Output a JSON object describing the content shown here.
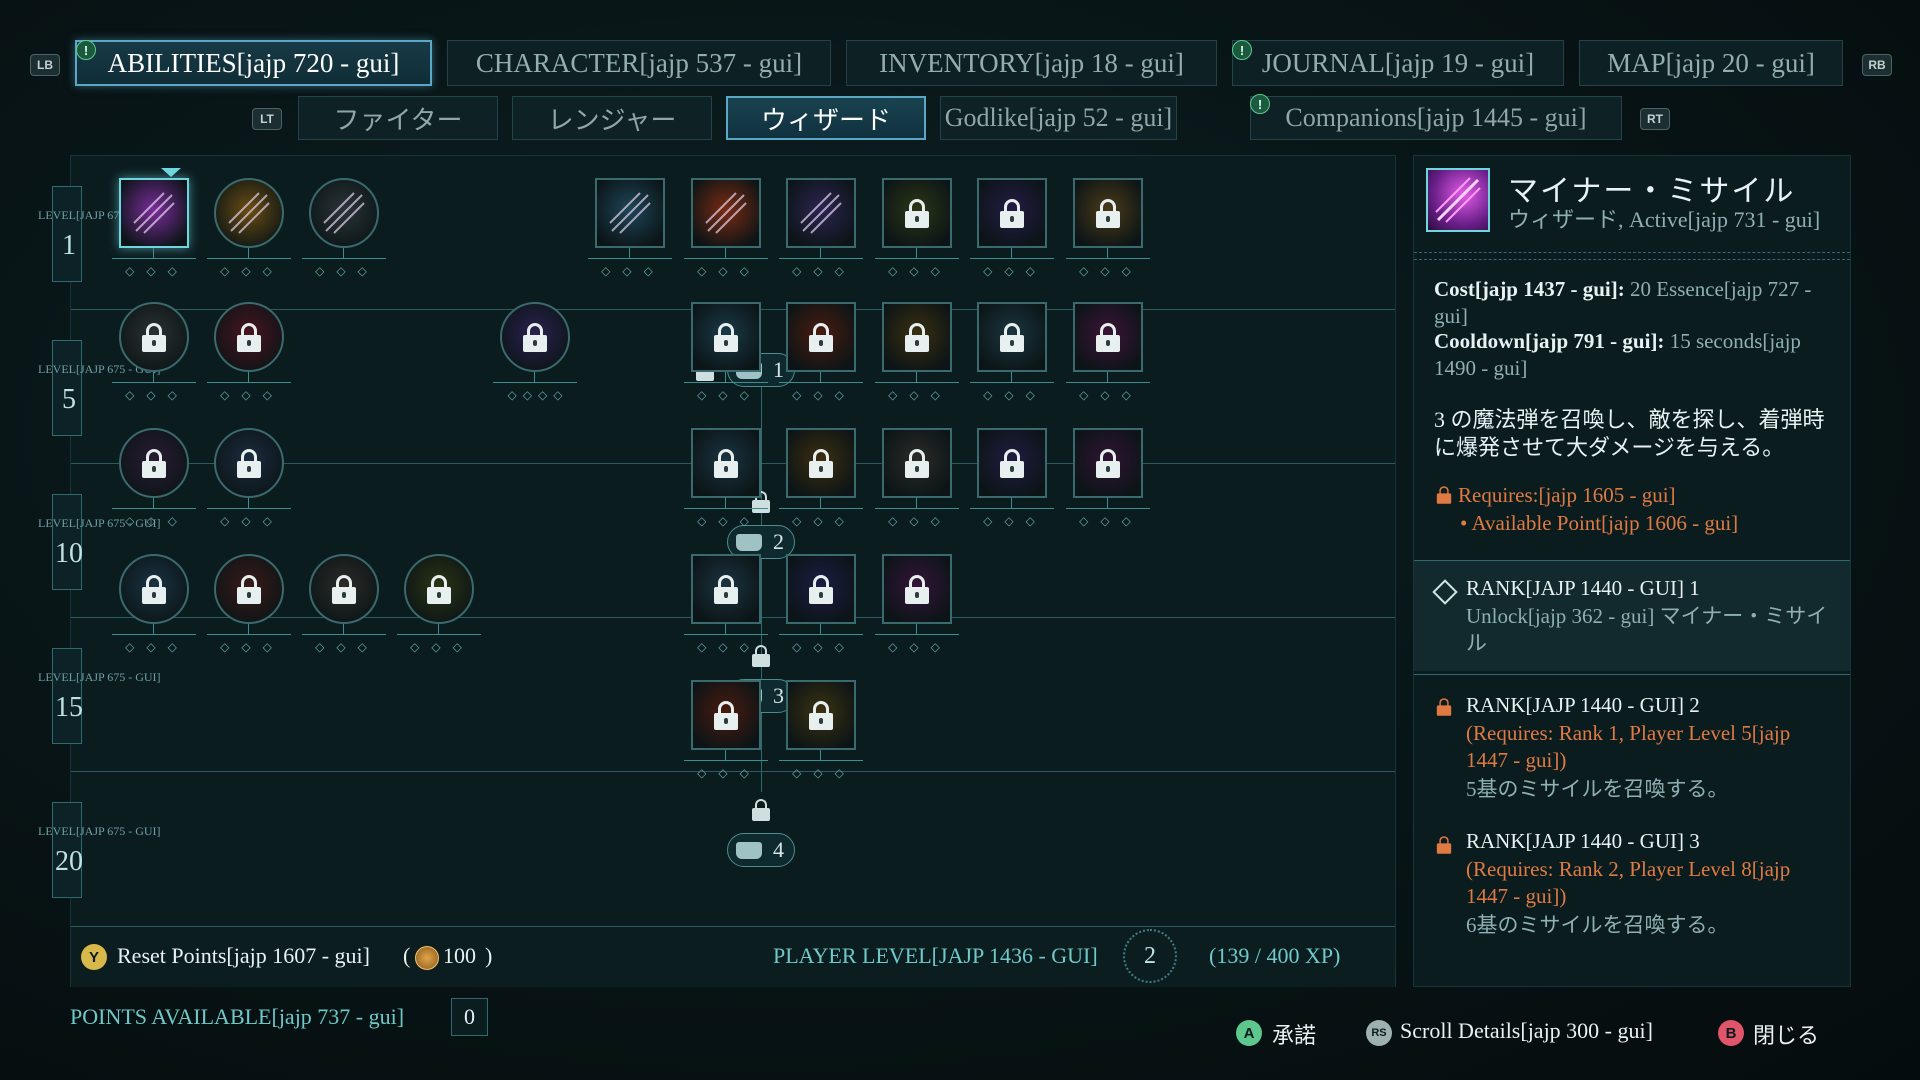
{
  "top_tabs": [
    {
      "label": "ABILITIES[jajp 720 - gui]",
      "active": true,
      "alert": true
    },
    {
      "label": "CHARACTER[jajp 537 - gui]",
      "active": false,
      "alert": false
    },
    {
      "label": "INVENTORY[jajp 18 - gui]",
      "active": false,
      "alert": false
    },
    {
      "label": "JOURNAL[jajp 19 - gui]",
      "active": false,
      "alert": true
    },
    {
      "label": "MAP[jajp 20 - gui]",
      "active": false,
      "alert": false
    }
  ],
  "bumpers": {
    "left": "LB",
    "right": "RB",
    "left_trigger": "LT",
    "right_trigger": "RT"
  },
  "sub_tabs": [
    {
      "label": "ファイター",
      "active": false,
      "alert": false
    },
    {
      "label": "レンジャー",
      "active": false,
      "alert": false
    },
    {
      "label": "ウィザード",
      "active": true,
      "alert": false
    },
    {
      "label": "Godlike[jajp 52 - gui]",
      "active": false,
      "alert": false
    },
    {
      "label": "Companions[jajp 1445 - gui]",
      "active": false,
      "alert": true
    }
  ],
  "tree": {
    "level_rows": [
      {
        "label": "LEVEL[JAJP 675 - GUI]",
        "level": "1"
      },
      {
        "label": "LEVEL[JAJP 675 - GUI]",
        "level": "5"
      },
      {
        "label": "LEVEL[JAJP 675 - GUI]",
        "level": "10"
      },
      {
        "label": "LEVEL[JAJP 675 - GUI]",
        "level": "15"
      },
      {
        "label": "LEVEL[JAJP 675 - GUI]",
        "level": "20"
      }
    ],
    "tier_markers": [
      "1",
      "2",
      "3",
      "4"
    ],
    "rows": [
      [
        {
          "name": "minor-missile",
          "shape": "square",
          "locked": false,
          "selected": true,
          "color": "#7a2c9a",
          "ranks": 3
        },
        {
          "name": "ability-gold-armor",
          "shape": "round",
          "locked": false,
          "selected": false,
          "color": "#6b4d12",
          "ranks": 3
        },
        {
          "name": "ability-wand",
          "shape": "round",
          "locked": false,
          "selected": false,
          "color": "#2b3438",
          "ranks": 3
        },
        {
          "name": "ability-blue-slash",
          "shape": "square",
          "locked": false,
          "selected": false,
          "color": "#1d4558",
          "ranks": 3
        },
        {
          "name": "ability-fire-fan",
          "shape": "square",
          "locked": false,
          "selected": false,
          "color": "#7a2a12",
          "ranks": 3
        },
        {
          "name": "ability-lightning-hand",
          "shape": "square",
          "locked": false,
          "selected": false,
          "color": "#2b2450",
          "ranks": 3
        },
        {
          "name": "ability-green-hand",
          "shape": "square",
          "locked": true,
          "selected": false,
          "color": "#2c3616",
          "ranks": 3
        },
        {
          "name": "ability-purple-blade",
          "shape": "square",
          "locked": true,
          "selected": false,
          "color": "#231c45",
          "ranks": 3
        },
        {
          "name": "ability-gold-hood",
          "shape": "square",
          "locked": true,
          "selected": false,
          "color": "#4a3a18",
          "ranks": 3
        }
      ],
      [
        {
          "name": "ability-grey-spikes",
          "shape": "round",
          "locked": true,
          "color": "#2b3233",
          "ranks": 3
        },
        {
          "name": "ability-red-burst",
          "shape": "round",
          "locked": true,
          "color": "#4a1420",
          "ranks": 3
        },
        {
          "name": "ability-violet-mage",
          "shape": "round",
          "locked": true,
          "color": "#2a2250",
          "ranks": 4
        },
        {
          "name": "ability-frost-shard",
          "shape": "square",
          "locked": true,
          "color": "#1a3a48",
          "ranks": 3
        },
        {
          "name": "ability-fire-swirl",
          "shape": "square",
          "locked": true,
          "color": "#4a1c10",
          "ranks": 3
        },
        {
          "name": "ability-golden-bolt",
          "shape": "square",
          "locked": true,
          "color": "#3a2f10",
          "ranks": 3
        },
        {
          "name": "ability-teal-wave",
          "shape": "square",
          "locked": true,
          "color": "#1a3640",
          "ranks": 3
        },
        {
          "name": "ability-pink-star",
          "shape": "square",
          "locked": true,
          "color": "#3c1438",
          "ranks": 3
        }
      ],
      [
        {
          "name": "ability-heart-shield",
          "shape": "round",
          "locked": true,
          "color": "#2a1c34",
          "ranks": 3
        },
        {
          "name": "ability-blue-blade",
          "shape": "round",
          "locked": true,
          "color": "#1c2c40",
          "ranks": 3
        },
        {
          "name": "ability-frost-hand",
          "shape": "square",
          "locked": true,
          "color": "#1a3440",
          "ranks": 3
        },
        {
          "name": "ability-gold-shield",
          "shape": "square",
          "locked": true,
          "color": "#3c2e10",
          "ranks": 3
        },
        {
          "name": "ability-storm-cloud",
          "shape": "square",
          "locked": true,
          "color": "#2a2c28",
          "ranks": 3
        },
        {
          "name": "ability-violet-dagger",
          "shape": "square",
          "locked": true,
          "color": "#201c40",
          "ranks": 3
        },
        {
          "name": "ability-arcane-face",
          "shape": "square",
          "locked": true,
          "color": "#301434",
          "ranks": 3
        }
      ],
      [
        {
          "name": "ability-blue-rune",
          "shape": "round",
          "locked": true,
          "color": "#1a3444",
          "ranks": 3
        },
        {
          "name": "ability-red-rune",
          "shape": "round",
          "locked": true,
          "color": "#3a1a18",
          "ranks": 3
        },
        {
          "name": "ability-stone-rune",
          "shape": "round",
          "locked": true,
          "color": "#2c2c28",
          "ranks": 3
        },
        {
          "name": "ability-olive-rune",
          "shape": "round",
          "locked": true,
          "color": "#2c3414",
          "ranks": 3
        },
        {
          "name": "ability-frost-fountain",
          "shape": "square",
          "locked": true,
          "color": "#1c3440",
          "ranks": 3
        },
        {
          "name": "ability-arcane-fist",
          "shape": "square",
          "locked": true,
          "color": "#1c1c44",
          "ranks": 3
        },
        {
          "name": "ability-pink-wisp",
          "shape": "square",
          "locked": true,
          "color": "#34143a",
          "ranks": 3
        }
      ],
      [
        {
          "name": "ability-flame-sword",
          "shape": "square",
          "locked": true,
          "color": "#4a1a10",
          "ranks": 3
        },
        {
          "name": "ability-gold-portal",
          "shape": "square",
          "locked": true,
          "color": "#3c3212",
          "ranks": 3
        }
      ]
    ]
  },
  "footer": {
    "reset_button": "Y",
    "reset_label": "Reset Points[jajp 1607 - gui]",
    "reset_cost_open": "(",
    "reset_cost": "100",
    "reset_cost_close": ")",
    "player_level_label": "PLAYER LEVEL[JAJP 1436 - GUI]",
    "player_level": "2",
    "xp": "(139 / 400 XP)",
    "points_label": "POINTS AVAILABLE[jajp 737 - gui]",
    "points_value": "0"
  },
  "detail": {
    "title": "マイナー・ミサイル",
    "subtitle": "ウィザード, Active[jajp 731 - gui]",
    "cost_label": "Cost[jajp 1437 - gui]:",
    "cost_value": "20 Essence[jajp 727 - gui]",
    "cooldown_label": "Cooldown[jajp 791 - gui]:",
    "cooldown_value": "15 seconds[jajp 1490 - gui]",
    "description": "3 の魔法弾を召喚し、敵を探し、着弾時に爆発させて大ダメージを与える。",
    "requires_label": "Requires:[jajp 1605 - gui]",
    "requires_item": "• Available Point[jajp 1606 - gui]",
    "ranks": [
      {
        "title": "RANK[JAJP 1440 - GUI] 1",
        "line1": "Unlock[jajp 362 - gui] マイナー・ミサイル",
        "requirement": "",
        "effect": "",
        "locked": false
      },
      {
        "title": "RANK[JAJP 1440 - GUI] 2",
        "line1": "",
        "requirement": "(Requires: Rank 1, Player Level 5[jajp 1447 - gui])",
        "effect": "5基のミサイルを召喚する。",
        "locked": true
      },
      {
        "title": "RANK[JAJP 1440 - GUI] 3",
        "line1": "",
        "requirement": "(Requires: Rank 2, Player Level 8[jajp 1447 - gui])",
        "effect": "6基のミサイルを召喚する。",
        "locked": true
      }
    ]
  },
  "hints": [
    {
      "button": "A",
      "label": "承諾",
      "color": "#5ec78e"
    },
    {
      "button": "RS",
      "label": "Scroll Details[jajp 300 - gui]",
      "color": "#9fb0b0"
    },
    {
      "button": "B",
      "label": "閉じる",
      "color": "#e0556a"
    }
  ],
  "colors": {
    "accent": "#5aa7c6",
    "teal": "#6fd6df",
    "orange": "#e07a43",
    "panel": "#0b1c1f"
  }
}
